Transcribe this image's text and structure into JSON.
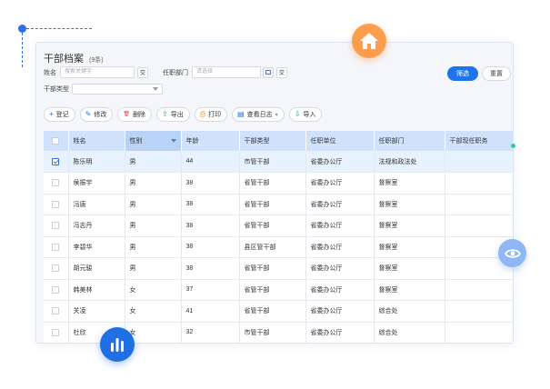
{
  "header": {
    "title": "干部档案",
    "count": "(9条)"
  },
  "filters": {
    "name_label": "姓名",
    "name_placeholder": "搜索关键字",
    "name_clear": "交",
    "dept_label": "任职部门",
    "dept_placeholder": "请选择",
    "dept_clear": "交",
    "type_label": "干部类型",
    "type_value": "",
    "search_label": "筛选",
    "reset_label": "重置"
  },
  "toolbar": {
    "register": {
      "icon": "+",
      "label": "登记"
    },
    "edit": {
      "icon": "✎",
      "label": "修改"
    },
    "delete": {
      "icon": "🗑",
      "label": "删除"
    },
    "export": {
      "icon": "⇪",
      "label": "导出"
    },
    "print": {
      "icon": "⎙",
      "label": "打印"
    },
    "log": {
      "icon": "▤",
      "label": "查看日志",
      "caret": "▾"
    },
    "import": {
      "icon": "⇩",
      "label": "导入"
    }
  },
  "table": {
    "columns": [
      "姓名",
      "性别",
      "年龄",
      "干部类型",
      "任职单位",
      "任职部门",
      "干部现任职务"
    ],
    "rows": [
      {
        "name": "陈乐明",
        "gender": "男",
        "age": "44",
        "type": "市管干部",
        "unit": "省委办公厅",
        "dept": "法规和政法处",
        "post": "",
        "checked": true
      },
      {
        "name": "侯振宇",
        "gender": "男",
        "age": "38",
        "type": "省管干部",
        "unit": "省委办公厅",
        "dept": "督察室",
        "post": "",
        "checked": false
      },
      {
        "name": "冯唐",
        "gender": "男",
        "age": "38",
        "type": "省管干部",
        "unit": "省委办公厅",
        "dept": "督察室",
        "post": "",
        "checked": false
      },
      {
        "name": "冯志丹",
        "gender": "男",
        "age": "38",
        "type": "省管干部",
        "unit": "省委办公厅",
        "dept": "督察室",
        "post": "",
        "checked": false
      },
      {
        "name": "李碧华",
        "gender": "男",
        "age": "38",
        "type": "县区管干部",
        "unit": "省委办公厅",
        "dept": "督察室",
        "post": "",
        "checked": false
      },
      {
        "name": "胡元骏",
        "gender": "男",
        "age": "38",
        "type": "省管干部",
        "unit": "省委办公厅",
        "dept": "督察室",
        "post": "",
        "checked": false
      },
      {
        "name": "韩美林",
        "gender": "女",
        "age": "37",
        "type": "省管干部",
        "unit": "省委办公厅",
        "dept": "督察室",
        "post": "",
        "checked": false
      },
      {
        "name": "关凌",
        "gender": "女",
        "age": "41",
        "type": "省管干部",
        "unit": "省委办公厅",
        "dept": "综合处",
        "post": "",
        "checked": false
      },
      {
        "name": "杜欣",
        "gender": "女",
        "age": "32",
        "type": "市管干部",
        "unit": "省委办公厅",
        "dept": "综合处",
        "post": "",
        "checked": false
      }
    ]
  },
  "colors": {
    "accent": "#1e74e8",
    "home_badge": "#ff9d4f",
    "eye_badge": "#8fb6f5",
    "chart_badge": "#1f6fe5",
    "header_bg": "#d0e2fb"
  },
  "icons": {
    "home": "home-icon",
    "eye": "eye-icon",
    "bar_chart": "bar-chart-icon"
  }
}
